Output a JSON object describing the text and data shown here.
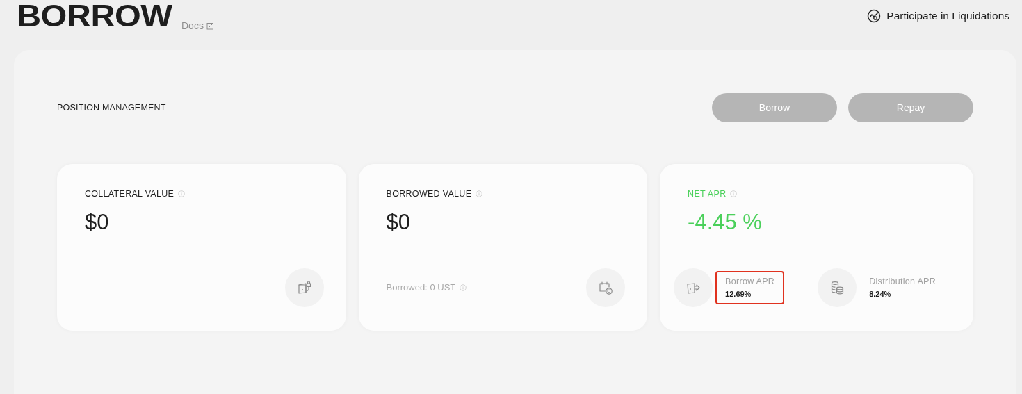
{
  "header": {
    "title": "BORROW",
    "docs_link": "Docs",
    "liquidations_link": "Participate in Liquidations"
  },
  "panel": {
    "title": "POSITION MANAGEMENT",
    "buttons": [
      {
        "label": "Borrow",
        "disabled": true
      },
      {
        "label": "Repay",
        "disabled": true
      }
    ],
    "cards": [
      {
        "kind": "plain",
        "title": "COLLATERAL VALUE",
        "value": "$0"
      },
      {
        "kind": "plain",
        "title": "BORROWED VALUE",
        "value": "$0",
        "footer": "Borrowed: 0 UST"
      },
      {
        "kind": "apr",
        "title": "NET APR",
        "value": "-4.45 %",
        "stats": [
          {
            "label": "Borrow APR",
            "value": "12.69%",
            "highlighted": true
          },
          {
            "label": "Distribution APR",
            "value": "8.24%",
            "highlighted": false
          }
        ]
      }
    ]
  }
}
